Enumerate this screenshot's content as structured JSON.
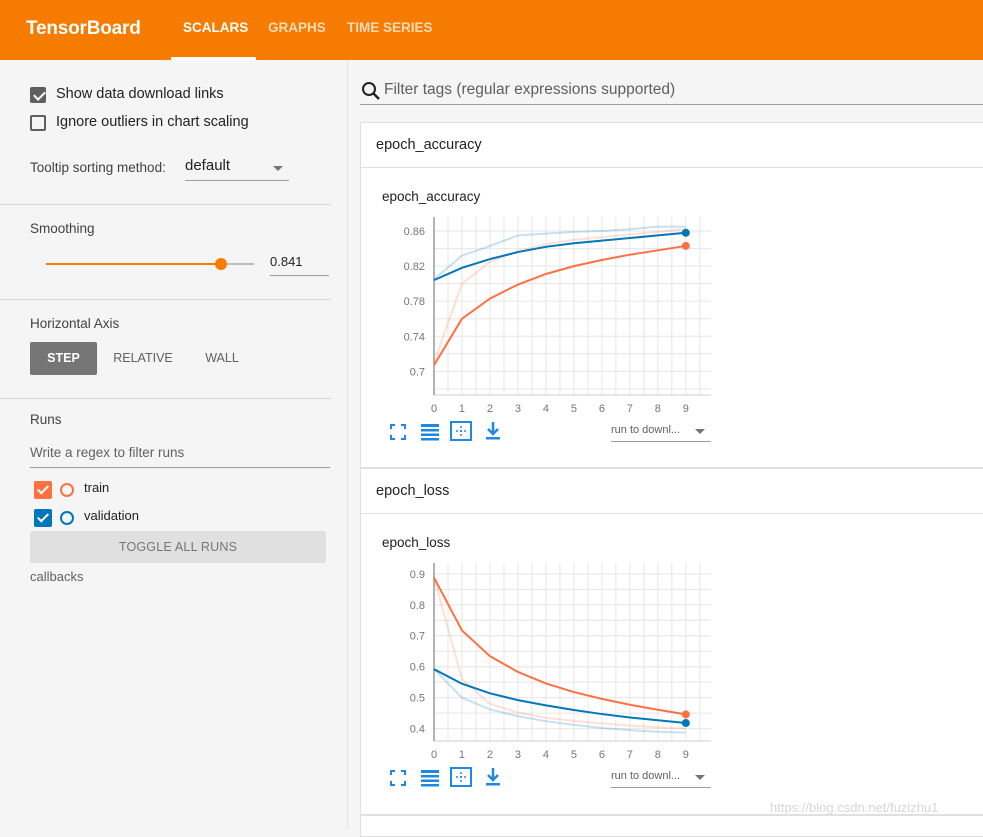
{
  "app": {
    "brand": "TensorBoard"
  },
  "nav": {
    "tabs": [
      {
        "label": "SCALARS"
      },
      {
        "label": "GRAPHS"
      },
      {
        "label": "TIME SERIES"
      }
    ],
    "active": "SCALARS"
  },
  "options": {
    "show_download": {
      "label": "Show data download links",
      "checked": true
    },
    "ignore_outliers": {
      "label": "Ignore outliers in chart scaling",
      "checked": false
    },
    "tooltip_label": "Tooltip sorting method:",
    "tooltip_value": "default"
  },
  "smoothing": {
    "label": "Smoothing",
    "value": "0.841",
    "level": 0.841
  },
  "horizontal_axis": {
    "label": "Horizontal Axis",
    "options": [
      "STEP",
      "RELATIVE",
      "WALL"
    ],
    "selected": "STEP"
  },
  "runs": {
    "label": "Runs",
    "filter_placeholder": "Write a regex to filter runs",
    "items": [
      {
        "name": "train",
        "color": "#ff7043",
        "checked": true
      },
      {
        "name": "validation",
        "color": "#0077bb",
        "checked": true
      }
    ],
    "toggle_label": "TOGGLE ALL RUNS",
    "footer": "callbacks"
  },
  "filter": {
    "placeholder": "Filter tags (regular expressions supported)"
  },
  "groups": [
    {
      "title": "epoch_accuracy",
      "card_title": "epoch_accuracy",
      "download_label": "run to downl..."
    },
    {
      "title": "epoch_loss",
      "card_title": "epoch_loss",
      "download_label": "run to downl..."
    }
  ],
  "chart_data": [
    {
      "type": "line",
      "title": "epoch_accuracy",
      "x": [
        0,
        1,
        2,
        3,
        4,
        5,
        6,
        7,
        8,
        9
      ],
      "xlim": [
        0,
        9.9
      ],
      "ylim": [
        0.673,
        0.876
      ],
      "yticks": [
        "0.86",
        "0.82",
        "0.78",
        "0.74",
        "0.7"
      ],
      "ytick_values": [
        0.86,
        0.82,
        0.78,
        0.74,
        0.7
      ],
      "grid": true,
      "series": [
        {
          "name": "train",
          "color": "#ff7043",
          "raw": [
            0.71,
            0.8,
            0.825,
            0.837,
            0.845,
            0.85,
            0.853,
            0.856,
            0.859,
            0.862
          ],
          "values": [
            0.707,
            0.76,
            0.783,
            0.799,
            0.811,
            0.82,
            0.827,
            0.833,
            0.838,
            0.843
          ]
        },
        {
          "name": "validation",
          "color": "#0077bb",
          "raw": [
            0.805,
            0.832,
            0.843,
            0.855,
            0.857,
            0.859,
            0.86,
            0.862,
            0.865,
            0.865
          ],
          "values": [
            0.804,
            0.818,
            0.828,
            0.836,
            0.842,
            0.846,
            0.849,
            0.852,
            0.855,
            0.858
          ]
        }
      ]
    },
    {
      "type": "line",
      "title": "epoch_loss",
      "x": [
        0,
        1,
        2,
        3,
        4,
        5,
        6,
        7,
        8,
        9
      ],
      "xlim": [
        0,
        9.9
      ],
      "ylim": [
        0.36,
        0.935
      ],
      "yticks": [
        "0.9",
        "0.8",
        "0.7",
        "0.6",
        "0.5",
        "0.4"
      ],
      "ytick_values": [
        0.9,
        0.8,
        0.7,
        0.6,
        0.5,
        0.4
      ],
      "grid": true,
      "series": [
        {
          "name": "train",
          "color": "#ff7043",
          "raw": [
            0.888,
            0.56,
            0.48,
            0.452,
            0.435,
            0.425,
            0.417,
            0.41,
            0.404,
            0.4
          ],
          "values": [
            0.888,
            0.717,
            0.634,
            0.583,
            0.546,
            0.518,
            0.496,
            0.477,
            0.461,
            0.446
          ]
        },
        {
          "name": "validation",
          "color": "#0077bb",
          "raw": [
            0.592,
            0.5,
            0.462,
            0.44,
            0.424,
            0.412,
            0.402,
            0.395,
            0.39,
            0.387
          ],
          "values": [
            0.592,
            0.545,
            0.514,
            0.492,
            0.475,
            0.46,
            0.447,
            0.436,
            0.427,
            0.418
          ]
        }
      ]
    }
  ],
  "watermark": "https://blog.csdn.net/fuzizhu1"
}
